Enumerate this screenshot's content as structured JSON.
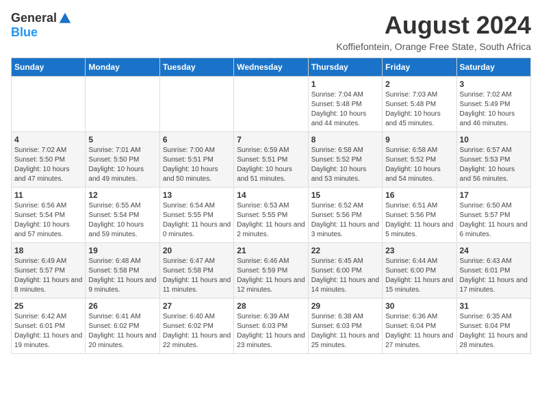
{
  "logo": {
    "general": "General",
    "blue": "Blue"
  },
  "title": "August 2024",
  "subtitle": "Koffiefontein, Orange Free State, South Africa",
  "days_header": [
    "Sunday",
    "Monday",
    "Tuesday",
    "Wednesday",
    "Thursday",
    "Friday",
    "Saturday"
  ],
  "weeks": [
    [
      {
        "day": "",
        "sunrise": "",
        "sunset": "",
        "daylight": ""
      },
      {
        "day": "",
        "sunrise": "",
        "sunset": "",
        "daylight": ""
      },
      {
        "day": "",
        "sunrise": "",
        "sunset": "",
        "daylight": ""
      },
      {
        "day": "",
        "sunrise": "",
        "sunset": "",
        "daylight": ""
      },
      {
        "day": "1",
        "sunrise": "Sunrise: 7:04 AM",
        "sunset": "Sunset: 5:48 PM",
        "daylight": "Daylight: 10 hours and 44 minutes."
      },
      {
        "day": "2",
        "sunrise": "Sunrise: 7:03 AM",
        "sunset": "Sunset: 5:48 PM",
        "daylight": "Daylight: 10 hours and 45 minutes."
      },
      {
        "day": "3",
        "sunrise": "Sunrise: 7:02 AM",
        "sunset": "Sunset: 5:49 PM",
        "daylight": "Daylight: 10 hours and 46 minutes."
      }
    ],
    [
      {
        "day": "4",
        "sunrise": "Sunrise: 7:02 AM",
        "sunset": "Sunset: 5:50 PM",
        "daylight": "Daylight: 10 hours and 47 minutes."
      },
      {
        "day": "5",
        "sunrise": "Sunrise: 7:01 AM",
        "sunset": "Sunset: 5:50 PM",
        "daylight": "Daylight: 10 hours and 49 minutes."
      },
      {
        "day": "6",
        "sunrise": "Sunrise: 7:00 AM",
        "sunset": "Sunset: 5:51 PM",
        "daylight": "Daylight: 10 hours and 50 minutes."
      },
      {
        "day": "7",
        "sunrise": "Sunrise: 6:59 AM",
        "sunset": "Sunset: 5:51 PM",
        "daylight": "Daylight: 10 hours and 51 minutes."
      },
      {
        "day": "8",
        "sunrise": "Sunrise: 6:58 AM",
        "sunset": "Sunset: 5:52 PM",
        "daylight": "Daylight: 10 hours and 53 minutes."
      },
      {
        "day": "9",
        "sunrise": "Sunrise: 6:58 AM",
        "sunset": "Sunset: 5:52 PM",
        "daylight": "Daylight: 10 hours and 54 minutes."
      },
      {
        "day": "10",
        "sunrise": "Sunrise: 6:57 AM",
        "sunset": "Sunset: 5:53 PM",
        "daylight": "Daylight: 10 hours and 56 minutes."
      }
    ],
    [
      {
        "day": "11",
        "sunrise": "Sunrise: 6:56 AM",
        "sunset": "Sunset: 5:54 PM",
        "daylight": "Daylight: 10 hours and 57 minutes."
      },
      {
        "day": "12",
        "sunrise": "Sunrise: 6:55 AM",
        "sunset": "Sunset: 5:54 PM",
        "daylight": "Daylight: 10 hours and 59 minutes."
      },
      {
        "day": "13",
        "sunrise": "Sunrise: 6:54 AM",
        "sunset": "Sunset: 5:55 PM",
        "daylight": "Daylight: 11 hours and 0 minutes."
      },
      {
        "day": "14",
        "sunrise": "Sunrise: 6:53 AM",
        "sunset": "Sunset: 5:55 PM",
        "daylight": "Daylight: 11 hours and 2 minutes."
      },
      {
        "day": "15",
        "sunrise": "Sunrise: 6:52 AM",
        "sunset": "Sunset: 5:56 PM",
        "daylight": "Daylight: 11 hours and 3 minutes."
      },
      {
        "day": "16",
        "sunrise": "Sunrise: 6:51 AM",
        "sunset": "Sunset: 5:56 PM",
        "daylight": "Daylight: 11 hours and 5 minutes."
      },
      {
        "day": "17",
        "sunrise": "Sunrise: 6:50 AM",
        "sunset": "Sunset: 5:57 PM",
        "daylight": "Daylight: 11 hours and 6 minutes."
      }
    ],
    [
      {
        "day": "18",
        "sunrise": "Sunrise: 6:49 AM",
        "sunset": "Sunset: 5:57 PM",
        "daylight": "Daylight: 11 hours and 8 minutes."
      },
      {
        "day": "19",
        "sunrise": "Sunrise: 6:48 AM",
        "sunset": "Sunset: 5:58 PM",
        "daylight": "Daylight: 11 hours and 9 minutes."
      },
      {
        "day": "20",
        "sunrise": "Sunrise: 6:47 AM",
        "sunset": "Sunset: 5:58 PM",
        "daylight": "Daylight: 11 hours and 11 minutes."
      },
      {
        "day": "21",
        "sunrise": "Sunrise: 6:46 AM",
        "sunset": "Sunset: 5:59 PM",
        "daylight": "Daylight: 11 hours and 12 minutes."
      },
      {
        "day": "22",
        "sunrise": "Sunrise: 6:45 AM",
        "sunset": "Sunset: 6:00 PM",
        "daylight": "Daylight: 11 hours and 14 minutes."
      },
      {
        "day": "23",
        "sunrise": "Sunrise: 6:44 AM",
        "sunset": "Sunset: 6:00 PM",
        "daylight": "Daylight: 11 hours and 15 minutes."
      },
      {
        "day": "24",
        "sunrise": "Sunrise: 6:43 AM",
        "sunset": "Sunset: 6:01 PM",
        "daylight": "Daylight: 11 hours and 17 minutes."
      }
    ],
    [
      {
        "day": "25",
        "sunrise": "Sunrise: 6:42 AM",
        "sunset": "Sunset: 6:01 PM",
        "daylight": "Daylight: 11 hours and 19 minutes."
      },
      {
        "day": "26",
        "sunrise": "Sunrise: 6:41 AM",
        "sunset": "Sunset: 6:02 PM",
        "daylight": "Daylight: 11 hours and 20 minutes."
      },
      {
        "day": "27",
        "sunrise": "Sunrise: 6:40 AM",
        "sunset": "Sunset: 6:02 PM",
        "daylight": "Daylight: 11 hours and 22 minutes."
      },
      {
        "day": "28",
        "sunrise": "Sunrise: 6:39 AM",
        "sunset": "Sunset: 6:03 PM",
        "daylight": "Daylight: 11 hours and 23 minutes."
      },
      {
        "day": "29",
        "sunrise": "Sunrise: 6:38 AM",
        "sunset": "Sunset: 6:03 PM",
        "daylight": "Daylight: 11 hours and 25 minutes."
      },
      {
        "day": "30",
        "sunrise": "Sunrise: 6:36 AM",
        "sunset": "Sunset: 6:04 PM",
        "daylight": "Daylight: 11 hours and 27 minutes."
      },
      {
        "day": "31",
        "sunrise": "Sunrise: 6:35 AM",
        "sunset": "Sunset: 6:04 PM",
        "daylight": "Daylight: 11 hours and 28 minutes."
      }
    ]
  ]
}
